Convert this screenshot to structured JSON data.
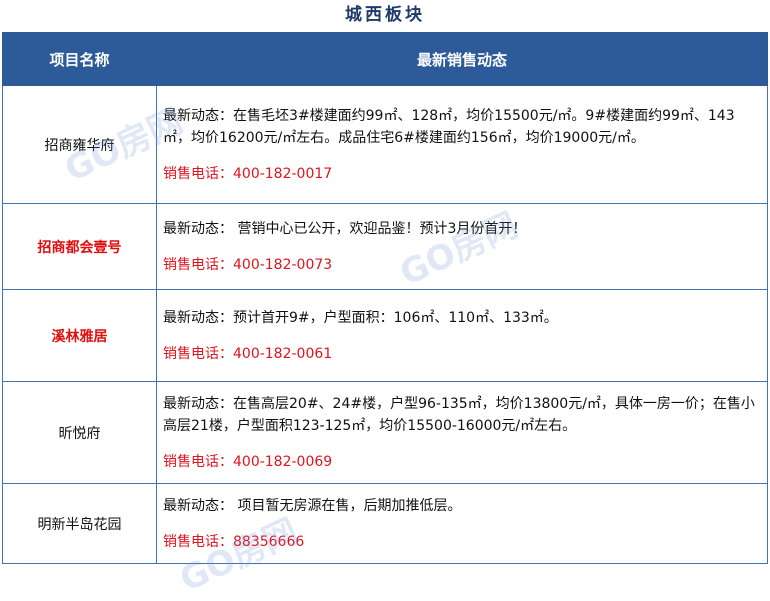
{
  "title": "城西板块",
  "header": {
    "name_col": "项目名称",
    "news_col": "最新销售动态"
  },
  "watermark": "GO房网",
  "rows": [
    {
      "name": "招商雍华府",
      "news": "最新动态：在售毛坯3#楼建面约99㎡、128㎡，均价15500元/㎡。9#楼建面约99㎡、143㎡，均价16200元/㎡左右。成品住宅6#楼建面约156㎡，均价19000元/㎡。",
      "tel": "销售电话：400-182-0017"
    },
    {
      "name": "招商都会壹号",
      "news": "最新动态： 营销中心已公开，欢迎品鉴！预计3月份首开！",
      "tel": "销售电话：400-182-0073"
    },
    {
      "name": "溪林雅居",
      "news": "最新动态：预计首开9#，户型面积：106㎡、110㎡、133㎡。",
      "tel": "销售电话：400-182-0061"
    },
    {
      "name": "昕悦府",
      "news": "最新动态：在售高层20#、24#楼，户型96-135㎡，均价13800元/㎡，具体一房一价；在售小高层21楼，户型面积123-125㎡，均价15500-16000元/㎡左右。",
      "tel": "销售电话：400-182-0069"
    },
    {
      "name": "明新半岛花园",
      "news": "最新动态： 项目暂无房源在售，后期加推低层。",
      "tel": "销售电话：88356666"
    }
  ]
}
